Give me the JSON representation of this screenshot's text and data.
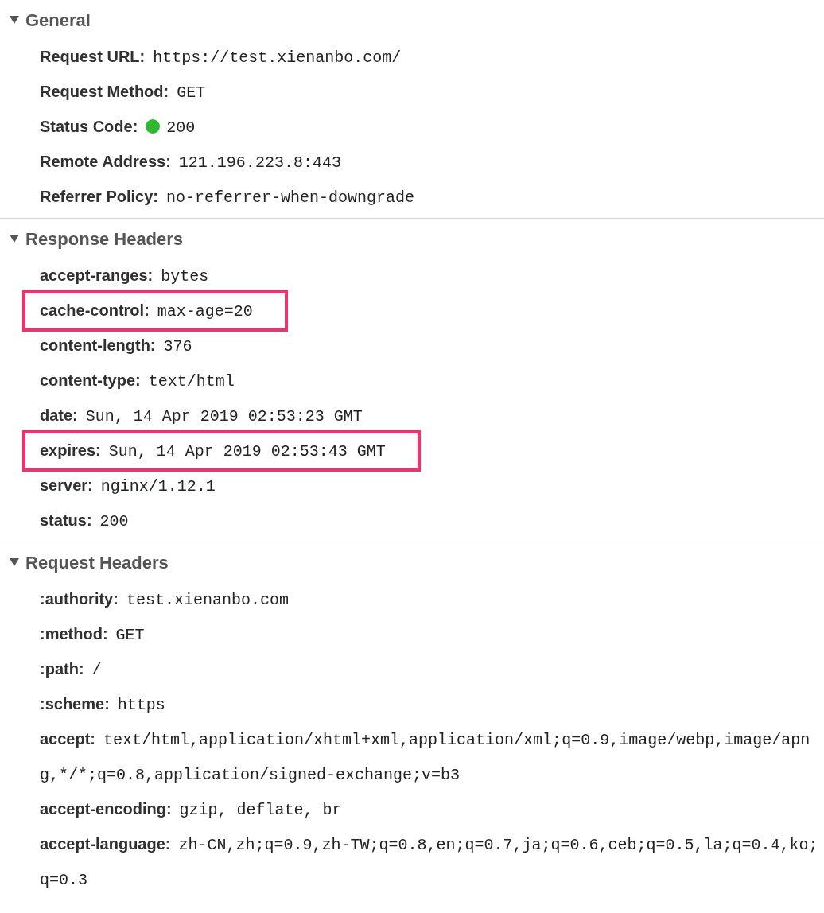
{
  "sections": [
    {
      "title": "General",
      "expanded": true,
      "rows": [
        {
          "label": "Request URL:",
          "value": "https://test.xienanbo.com/",
          "highlighted": false
        },
        {
          "label": "Request Method:",
          "value": "GET",
          "highlighted": false
        },
        {
          "label": "Status Code:",
          "value": "200",
          "color": "#2fb82f",
          "highlighted": false
        },
        {
          "label": "Remote Address:",
          "value": "121.196.223.8:443",
          "highlighted": false
        },
        {
          "label": "Referrer Policy:",
          "value": "no-referrer-when-downgrade",
          "highlighted": false
        }
      ]
    },
    {
      "title": "Response Headers",
      "expanded": true,
      "rows": [
        {
          "label": "accept-ranges:",
          "value": "bytes",
          "highlighted": false
        },
        {
          "label": "cache-control:",
          "value": "max-age=20",
          "highlighted": true
        },
        {
          "label": "content-length:",
          "value": "376",
          "highlighted": false
        },
        {
          "label": "content-type:",
          "value": "text/html",
          "highlighted": false
        },
        {
          "label": "date:",
          "value": "Sun, 14 Apr 2019 02:53:23 GMT",
          "highlighted": false
        },
        {
          "label": "expires:",
          "value": "Sun, 14 Apr 2019 02:53:43 GMT",
          "highlighted": true
        },
        {
          "label": "server:",
          "value": "nginx/1.12.1",
          "highlighted": false
        },
        {
          "label": "status:",
          "value": "200",
          "highlighted": false
        }
      ]
    },
    {
      "title": "Request Headers",
      "expanded": true,
      "rows": [
        {
          "label": ":authority:",
          "value": "test.xienanbo.com",
          "highlighted": false
        },
        {
          "label": ":method:",
          "value": "GET",
          "highlighted": false
        },
        {
          "label": ":path:",
          "value": "/",
          "highlighted": false
        },
        {
          "label": ":scheme:",
          "value": "https",
          "highlighted": false
        },
        {
          "label": "accept:",
          "value": "text/html,application/xhtml+xml,application/xml;q=0.9,image/webp,image/apng,*/*;q=0.8,application/signed-exchange;v=b3",
          "highlighted": false
        },
        {
          "label": "accept-encoding:",
          "value": "gzip, deflate, br",
          "highlighted": false
        },
        {
          "label": "accept-language:",
          "value": "zh-CN,zh;q=0.9,zh-TW;q=0.8,en;q=0.7,ja;q=0.6,ceb;q=0.5,la;q=0.4,ko;q=0.3",
          "highlighted": false
        }
      ]
    }
  ]
}
